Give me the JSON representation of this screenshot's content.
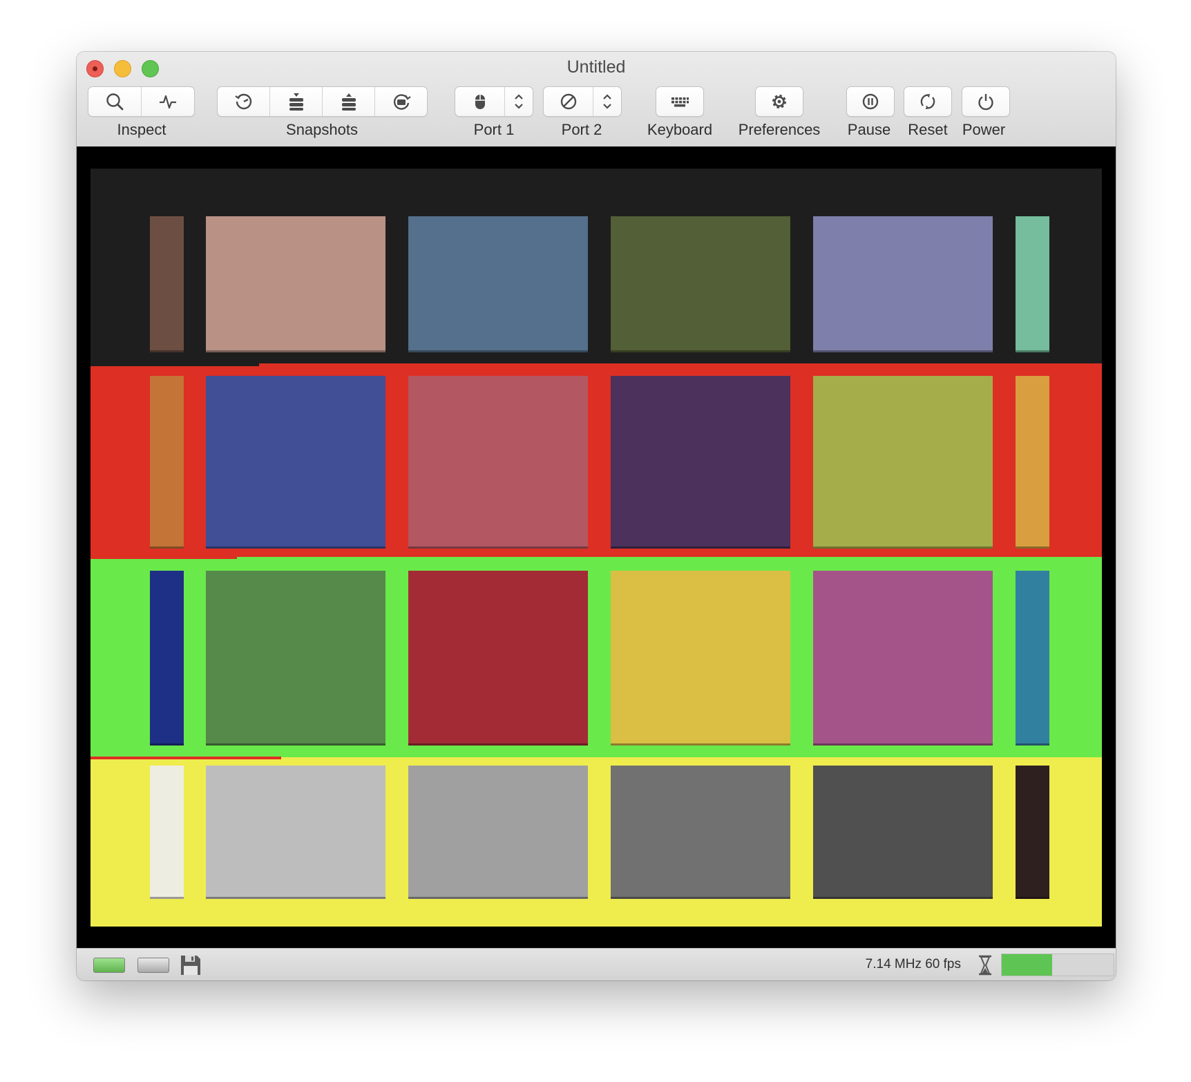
{
  "window": {
    "title": "Untitled"
  },
  "toolbar": {
    "inspect_label": "Inspect",
    "snapshots_label": "Snapshots",
    "port1_label": "Port 1",
    "port2_label": "Port 2",
    "keyboard_label": "Keyboard",
    "preferences_label": "Preferences",
    "pause_label": "Pause",
    "reset_label": "Reset",
    "power_label": "Power"
  },
  "screen": {
    "background": "#1e1e1e",
    "bands": [
      "#1e1e1e",
      "#dd2f24",
      "#6ae94a",
      "#efec4e"
    ],
    "rows": [
      [
        "#6c4e42",
        "#b99185",
        "#54708c",
        "#535f36",
        "#7f7fab",
        "#75bd9d"
      ],
      [
        "#c47436",
        "#414f97",
        "#b35762",
        "#4b315b",
        "#a5ad4a",
        "#d89e3f"
      ],
      [
        "#1e2f86",
        "#558a4a",
        "#a22b36",
        "#dbbe44",
        "#a5548a",
        "#32809f"
      ],
      [
        "#eeede2",
        "#bdbdbd",
        "#a0a0a0",
        "#717171",
        "#505050",
        "#2e201f"
      ]
    ]
  },
  "status": {
    "speed_text": "7.14 MHz 60 fps",
    "load_fraction": 0.45,
    "meter_color": "#5ec453"
  }
}
